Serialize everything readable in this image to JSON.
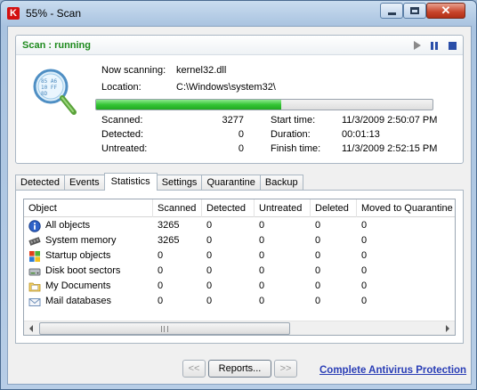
{
  "window": {
    "title": "55% - Scan",
    "app_icon_letter": "K"
  },
  "status": {
    "title": "Scan : running",
    "now_scanning_label": "Now scanning:",
    "now_scanning_value": "kernel32.dll",
    "location_label": "Location:",
    "location_value": "C:\\Windows\\system32\\",
    "progress_fraction": 0.55,
    "progress_color": "#35c635",
    "stats": {
      "scanned_label": "Scanned:",
      "scanned_value": "3277",
      "detected_label": "Detected:",
      "detected_value": "0",
      "untreated_label": "Untreated:",
      "untreated_value": "0",
      "start_label": "Start time:",
      "start_value": "11/3/2009 2:50:07 PM",
      "duration_label": "Duration:",
      "duration_value": "00:01:13",
      "finish_label": "Finish time:",
      "finish_value": "11/3/2009 2:52:15 PM"
    },
    "controls": [
      "play-icon",
      "pause-icon",
      "stop-icon"
    ],
    "title_color": "#1d8a1d"
  },
  "tabs": [
    "Detected",
    "Events",
    "Statistics",
    "Settings",
    "Quarantine",
    "Backup"
  ],
  "active_tab": "Statistics",
  "table": {
    "columns": [
      "Object",
      "Scanned",
      "Detected",
      "Untreated",
      "Deleted",
      "Moved to Quarantine"
    ],
    "rows": [
      {
        "icon": "info-icon",
        "object": "All objects",
        "scanned": "3265",
        "detected": "0",
        "untreated": "0",
        "deleted": "0",
        "moved": "0"
      },
      {
        "icon": "memory-chip-icon",
        "object": "System memory",
        "scanned": "3265",
        "detected": "0",
        "untreated": "0",
        "deleted": "0",
        "moved": "0"
      },
      {
        "icon": "windows-logo-icon",
        "object": "Startup objects",
        "scanned": "0",
        "detected": "0",
        "untreated": "0",
        "deleted": "0",
        "moved": "0"
      },
      {
        "icon": "disk-icon",
        "object": "Disk boot sectors",
        "scanned": "0",
        "detected": "0",
        "untreated": "0",
        "deleted": "0",
        "moved": "0"
      },
      {
        "icon": "folder-icon",
        "object": "My Documents",
        "scanned": "0",
        "detected": "0",
        "untreated": "0",
        "deleted": "0",
        "moved": "0"
      },
      {
        "icon": "mail-icon",
        "object": "Mail databases",
        "scanned": "0",
        "detected": "0",
        "untreated": "0",
        "deleted": "0",
        "moved": "0"
      }
    ]
  },
  "footer": {
    "prev_label": "<<",
    "reports_label": "Reports...",
    "next_label": ">>",
    "link_label": "Complete Antivirus Protection",
    "link_color": "#2a3eb6"
  }
}
